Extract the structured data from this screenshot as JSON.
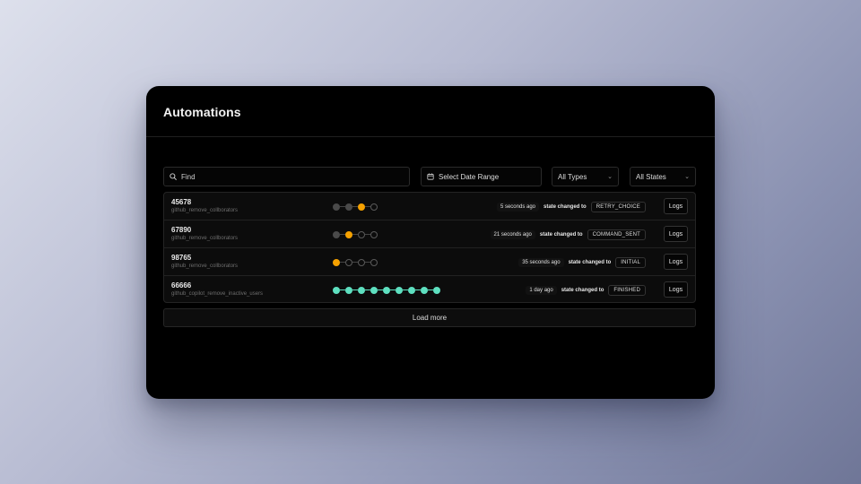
{
  "header": {
    "title": "Automations"
  },
  "filters": {
    "search_placeholder": "Find",
    "date_label": "Select Date Range",
    "types_value": "All Types",
    "states_value": "All States"
  },
  "rows": [
    {
      "id": "45678",
      "name": "github_remove_collborators",
      "steps": [
        "done",
        "done",
        "active",
        "pending"
      ],
      "time": "5 seconds ago",
      "changed_label": "state changed to",
      "state": "RETRY_CHOICE",
      "logs_label": "Logs"
    },
    {
      "id": "67890",
      "name": "github_remove_collborators",
      "steps": [
        "done",
        "active",
        "pending",
        "pending"
      ],
      "time": "21 seconds ago",
      "changed_label": "state changed to",
      "state": "COMMAND_SENT",
      "logs_label": "Logs"
    },
    {
      "id": "98765",
      "name": "github_remove_collborators",
      "steps": [
        "active",
        "pending",
        "pending",
        "pending"
      ],
      "time": "35 seconds ago",
      "changed_label": "state changed to",
      "state": "INITIAL",
      "logs_label": "Logs"
    },
    {
      "id": "66666",
      "name": "github_copilot_remove_inactive_users",
      "steps": [
        "finished",
        "finished",
        "finished",
        "finished",
        "finished",
        "finished",
        "finished",
        "finished",
        "finished"
      ],
      "time": "1 day ago",
      "changed_label": "state changed to",
      "state": "FINISHED",
      "logs_label": "Logs"
    }
  ],
  "load_more_label": "Load more",
  "colors": {
    "active": "#f5a100",
    "finished": "#5ee0c0",
    "done": "#4a4a4a",
    "background": "#000000"
  },
  "icons": {
    "search": "search-icon",
    "calendar": "calendar-icon",
    "dropdown": "chevron-down-icon"
  }
}
